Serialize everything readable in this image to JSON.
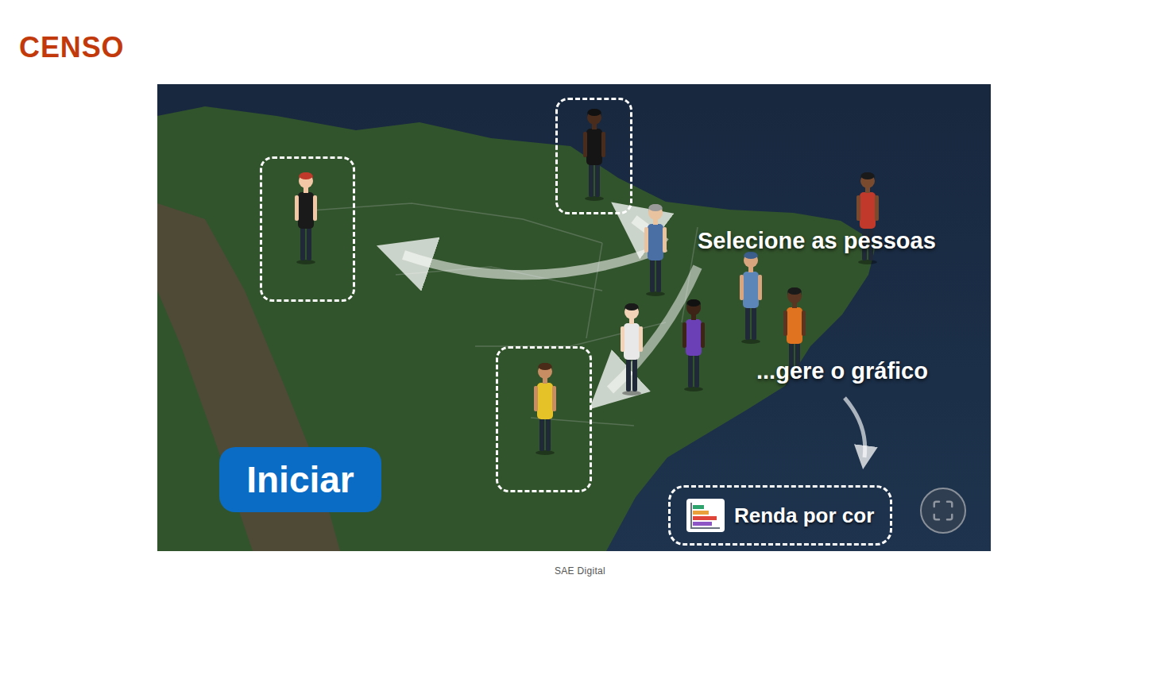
{
  "header": {
    "title": "CENSO"
  },
  "stage": {
    "instructions": [
      "Selecione as pessoas",
      "...gere o gráfico"
    ],
    "start_button": "Iniciar",
    "chart_button": {
      "label": "Renda por cor",
      "highlighted": true
    },
    "people": [
      {
        "selected": true,
        "color": "#1a1a1a"
      },
      {
        "selected": true,
        "color": "#151515"
      },
      {
        "selected": false,
        "color": "#4a6fa5"
      },
      {
        "selected": false,
        "color": "#c0392b"
      },
      {
        "selected": false,
        "color": "#5d86b8"
      },
      {
        "selected": false,
        "color": "#e0731f"
      },
      {
        "selected": false,
        "color": "#6b3fb5"
      },
      {
        "selected": false,
        "color": "#e8e8e8"
      },
      {
        "selected": true,
        "color": "#e6c229"
      }
    ]
  },
  "caption": "SAE Digital"
}
